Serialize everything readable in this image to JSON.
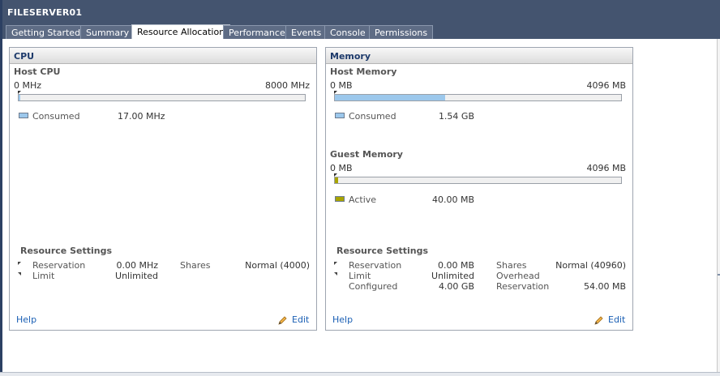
{
  "window": {
    "title": "FILESERVER01"
  },
  "tabs": [
    {
      "label": "Getting Started"
    },
    {
      "label": "Summary"
    },
    {
      "label": "Resource Allocation"
    },
    {
      "label": "Performance"
    },
    {
      "label": "Events"
    },
    {
      "label": "Console"
    },
    {
      "label": "Permissions"
    }
  ],
  "active_tab": "Resource Allocation",
  "cpu": {
    "title": "CPU",
    "host": {
      "title": "Host CPU",
      "min_label": "0 MHz",
      "max_label": "8000 MHz",
      "consumed_fraction": 0.002,
      "legend_label": "Consumed",
      "legend_value": "17.00 MHz",
      "legend_color": "#9cc8ec"
    },
    "settings": {
      "title": "Resource Settings",
      "reservation_label": "Reservation",
      "reservation_value": "0.00 MHz",
      "limit_label": "Limit",
      "limit_value": "Unlimited",
      "shares_label": "Shares",
      "shares_value": "Normal (4000)"
    },
    "help": "Help",
    "edit": "Edit"
  },
  "memory": {
    "title": "Memory",
    "host": {
      "title": "Host Memory",
      "min_label": "0 MB",
      "max_label": "4096 MB",
      "consumed_fraction": 0.385,
      "legend_label": "Consumed",
      "legend_value": "1.54 GB",
      "legend_color": "#9cc8ec"
    },
    "guest": {
      "title": "Guest Memory",
      "min_label": "0 MB",
      "max_label": "4096 MB",
      "active_fraction": 0.01,
      "legend_label": "Active",
      "legend_value": "40.00 MB",
      "legend_color": "#a8a400"
    },
    "settings": {
      "title": "Resource Settings",
      "reservation_label": "Reservation",
      "reservation_value": "0.00 MB",
      "limit_label": "Limit",
      "limit_value": "Unlimited",
      "configured_label": "Configured",
      "configured_value": "4.00 GB",
      "shares_label": "Shares",
      "shares_value": "Normal (40960)",
      "overhead_label": "Overhead",
      "overhead_reservation_label": "Reservation",
      "overhead_reservation_value": "54.00 MB"
    },
    "help": "Help",
    "edit": "Edit"
  }
}
